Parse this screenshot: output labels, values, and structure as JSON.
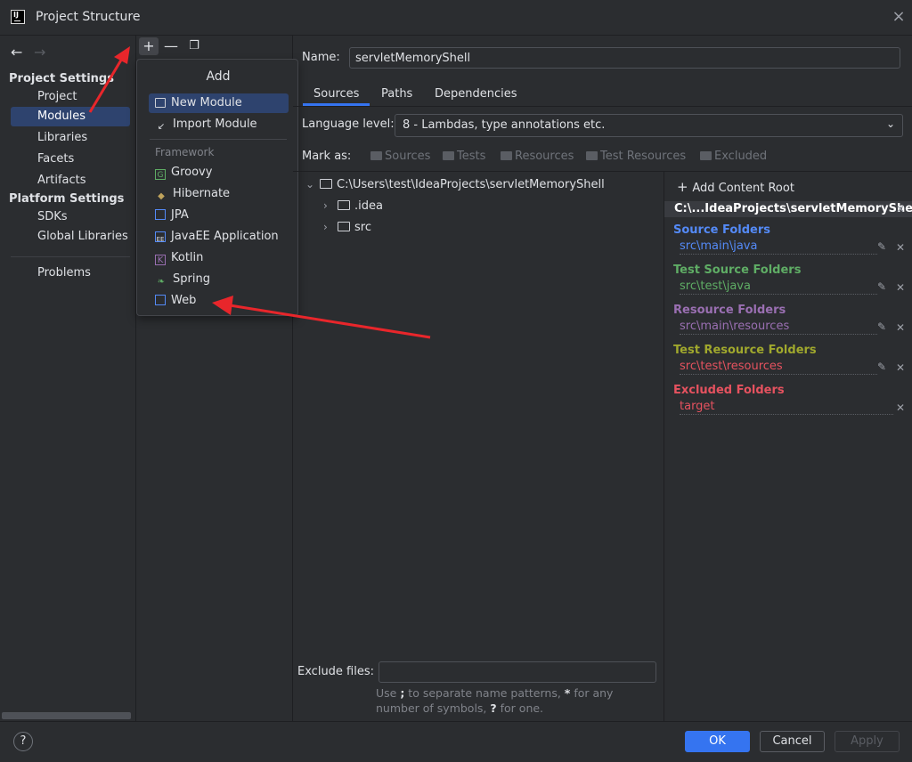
{
  "window": {
    "title": "Project Structure",
    "app_icon_text": "IJ"
  },
  "left_nav": {
    "project_settings_heading": "Project Settings",
    "project_items": [
      "Project",
      "Modules",
      "Libraries",
      "Facets",
      "Artifacts"
    ],
    "platform_settings_heading": "Platform Settings",
    "platform_items": [
      "SDKs",
      "Global Libraries"
    ],
    "problems": "Problems",
    "selected": "Modules"
  },
  "add_popup": {
    "title": "Add",
    "items": [
      "New Module",
      "Import Module"
    ],
    "framework_heading": "Framework",
    "frameworks": [
      "Groovy",
      "Hibernate",
      "JPA",
      "JavaEE Application",
      "Kotlin",
      "Spring",
      "Web"
    ],
    "selected": "New Module"
  },
  "module": {
    "name_label": "Name:",
    "name_value": "servletMemoryShell",
    "tabs": [
      "Sources",
      "Paths",
      "Dependencies"
    ],
    "active_tab": "Sources",
    "language_label": "Language level:",
    "language_value": "8 - Lambdas, type annotations etc.",
    "mark_as_label": "Mark as:",
    "mark_buttons": [
      "Sources",
      "Tests",
      "Resources",
      "Test Resources",
      "Excluded"
    ]
  },
  "tree": {
    "root": "C:\\Users\\test\\IdeaProjects\\servletMemoryShell",
    "children": [
      ".idea",
      "src"
    ]
  },
  "content_root": {
    "add_label": "Add Content Root",
    "root_path": "C:\\...IdeaProjects\\servletMemoryShell",
    "groups": [
      {
        "heading": "Source Folders",
        "path": "src\\main\\java",
        "color": "#548af7"
      },
      {
        "heading": "Test Source Folders",
        "path": "src\\test\\java",
        "color": "#5fad65"
      },
      {
        "heading": "Resource Folders",
        "path": "src\\main\\resources",
        "color": "#9a6fb2"
      },
      {
        "heading": "Test Resource Folders",
        "path": "src\\test\\resources",
        "color": "#a0a82d"
      },
      {
        "heading": "Excluded Folders",
        "path": "target",
        "color": "#e5525f"
      }
    ]
  },
  "exclude": {
    "label": "Exclude files:",
    "value": "",
    "hint_part1": "Use ",
    "hint_sep": ";",
    "hint_part2": " to separate name patterns, ",
    "hint_star": "*",
    "hint_part3": " for any number of symbols, ",
    "hint_q": "?",
    "hint_part4": " for one."
  },
  "footer": {
    "help": "?",
    "ok": "OK",
    "cancel": "Cancel",
    "apply": "Apply"
  },
  "colors": {
    "accent": "#3574f0",
    "annotation_arrow": "#e8262b"
  }
}
